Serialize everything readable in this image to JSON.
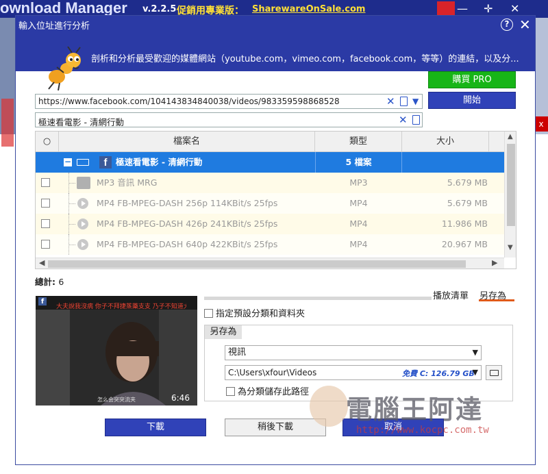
{
  "app": {
    "title_fragment": "ownload Manager",
    "version": "v.2.2.5",
    "promo": "促銷用專業版：",
    "promo_link": "SharewareOnSale.com"
  },
  "dialog": {
    "title": "輸入位址進行分析",
    "description": "剖析和分析最受歡迎的媒體網站（youtube.com，vimeo.com，facebook.com，等等）的連結，以及分..."
  },
  "url_input": {
    "value": "https://www.facebook.com/104143834840038/videos/983359598868528"
  },
  "name_input": {
    "value": "極速看電影 - 清網行動"
  },
  "buttons": {
    "buy_pro": "購買 PRO",
    "start": "開始",
    "download": "下載",
    "download_later": "稍後下載",
    "cancel": "取消"
  },
  "table": {
    "headers": {
      "check": "○",
      "name": "檔案名",
      "type": "類型",
      "size": "大小"
    },
    "group": {
      "name": "極速看電影 - 清網行動",
      "type": "5 檔案"
    },
    "rows": [
      {
        "name": "MP3 音訊 MRG",
        "type": "MP3",
        "size": "5.679 MB"
      },
      {
        "name": "MP4 FB-MPEG-DASH 256p 114KBit/s 25fps",
        "type": "MP4",
        "size": "5.679 MB"
      },
      {
        "name": "MP4 FB-MPEG-DASH 426p 241KBit/s 25fps",
        "type": "MP4",
        "size": "11.986 MB"
      },
      {
        "name": "MP4 FB-MPEG-DASH 640p 422KBit/s 25fps",
        "type": "MP4",
        "size": "20.967 MB"
      }
    ]
  },
  "total": {
    "label": "總計:",
    "count": "6"
  },
  "tabs": {
    "playlist": "播放清單",
    "save_as": "另存為"
  },
  "thumbnail": {
    "caption": "大夫說我沒病 你子不拜捷蒸藥支支 乃子不知道大夫說的",
    "subtitle": "怎么会突突流夹",
    "duration": "6:46"
  },
  "options": {
    "use_default": "指定預設分類和資料夾",
    "save_as_label": "另存為",
    "category": "視訊",
    "path": "C:\\Users\\xfour\\Videos",
    "free_space": "免費 C: 126.79 GB",
    "save_path_for_category": "為分類儲存此路徑"
  },
  "watermark": {
    "text": "電腦王阿達",
    "url": "http://www.kocpc.com.tw"
  },
  "colors": {
    "header": "#2b3aa5",
    "selected_row": "#1f7be0",
    "buy_button": "#17b517",
    "primary_button": "#3042b8",
    "tab_accent": "#e05a1a"
  }
}
